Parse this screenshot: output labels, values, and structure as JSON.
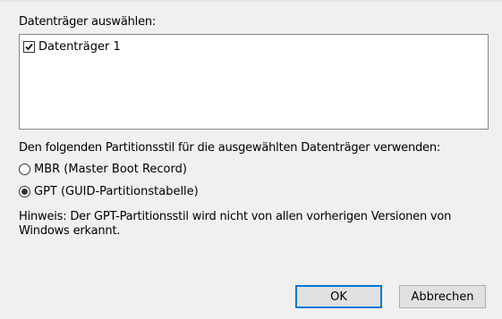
{
  "dialog": {
    "disk_label": "Datenträger auswählen:",
    "disks": [
      {
        "label": "Datenträger 1",
        "checked": true
      }
    ],
    "partition_style_label": "Den folgenden Partitionsstil für die ausgewählten Datenträger verwenden:",
    "options": {
      "mbr": {
        "label": "MBR (Master Boot Record)",
        "selected": false
      },
      "gpt": {
        "label": "GPT (GUID-Partitionstabelle)",
        "selected": true
      }
    },
    "hint": "Hinweis: Der GPT-Partitionsstil wird nicht von allen vorherigen Versionen von Windows erkannt.",
    "buttons": {
      "ok": "OK",
      "cancel": "Abbrechen"
    }
  },
  "colors": {
    "background": "#f0f0f0",
    "list_border": "#828790",
    "focus_border": "#0078d7",
    "button_face": "#e1e1e1"
  }
}
